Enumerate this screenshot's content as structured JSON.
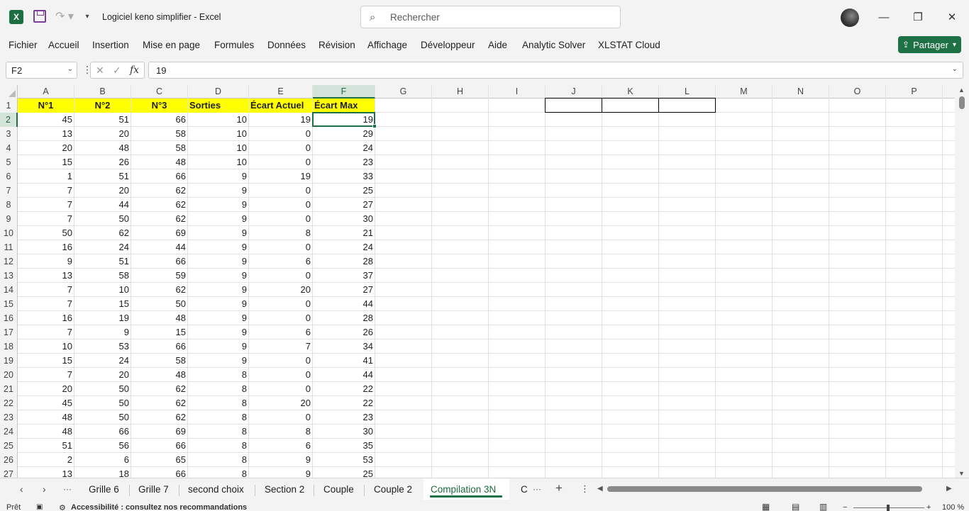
{
  "titlebar": {
    "app_logo": "X",
    "document_title": "Logiciel keno simplifier  -  Excel",
    "search_placeholder": "Rechercher",
    "icons": {
      "save": "save-icon",
      "redo": "redo-icon",
      "customize": "chevron-down-icon",
      "search": "search-icon",
      "minimize": "minimize-icon",
      "restore": "restore-icon",
      "close": "close-icon"
    },
    "window_controls": {
      "minimize": "—",
      "restore": "❐",
      "close": "✕"
    }
  },
  "menu": {
    "items": [
      "Fichier",
      "Accueil",
      "Insertion",
      "Mise en page",
      "Formules",
      "Données",
      "Révision",
      "Affichage",
      "Développeur",
      "Aide",
      "Analytic Solver",
      "XLSTAT Cloud"
    ],
    "share_label": "Partager"
  },
  "formula_bar": {
    "name_box": "F2",
    "formula_value": "19",
    "fx_label": "fx"
  },
  "sheet": {
    "columns": [
      "A",
      "B",
      "C",
      "D",
      "E",
      "F",
      "G",
      "H",
      "I",
      "J",
      "K",
      "L",
      "M",
      "N",
      "O",
      "P"
    ],
    "active_column": "F",
    "active_row": 2,
    "header_row": [
      "N°1",
      "N°2",
      "N°3",
      "Sorties",
      "Écart Actuel",
      "Écart Max"
    ],
    "rows": [
      [
        45,
        51,
        66,
        10,
        19,
        19
      ],
      [
        13,
        20,
        58,
        10,
        0,
        29
      ],
      [
        20,
        48,
        58,
        10,
        0,
        24
      ],
      [
        15,
        26,
        48,
        10,
        0,
        23
      ],
      [
        1,
        51,
        66,
        9,
        19,
        33
      ],
      [
        7,
        20,
        62,
        9,
        0,
        25
      ],
      [
        7,
        44,
        62,
        9,
        0,
        27
      ],
      [
        7,
        50,
        62,
        9,
        0,
        30
      ],
      [
        50,
        62,
        69,
        9,
        8,
        21
      ],
      [
        16,
        24,
        44,
        9,
        0,
        24
      ],
      [
        9,
        51,
        66,
        9,
        6,
        28
      ],
      [
        13,
        58,
        59,
        9,
        0,
        37
      ],
      [
        7,
        10,
        62,
        9,
        20,
        27
      ],
      [
        7,
        15,
        50,
        9,
        0,
        44
      ],
      [
        16,
        19,
        48,
        9,
        0,
        28
      ],
      [
        7,
        9,
        15,
        9,
        6,
        26
      ],
      [
        10,
        53,
        66,
        9,
        7,
        34
      ],
      [
        15,
        24,
        58,
        9,
        0,
        41
      ],
      [
        7,
        20,
        48,
        8,
        0,
        44
      ],
      [
        20,
        50,
        62,
        8,
        0,
        22
      ],
      [
        45,
        50,
        62,
        8,
        20,
        22
      ],
      [
        48,
        50,
        62,
        8,
        0,
        23
      ],
      [
        48,
        66,
        69,
        8,
        8,
        30
      ],
      [
        51,
        56,
        66,
        8,
        6,
        35
      ],
      [
        2,
        6,
        65,
        8,
        9,
        53
      ],
      [
        13,
        18,
        66,
        8,
        9,
        25
      ]
    ],
    "row_numbers": [
      1,
      2,
      3,
      4,
      5,
      6,
      7,
      8,
      9,
      10,
      11,
      12,
      13,
      14,
      15,
      16,
      17,
      18,
      19,
      20,
      21,
      22,
      23,
      24,
      25,
      26,
      27
    ]
  },
  "sheet_tabs": {
    "tabs": [
      "Grille 6",
      "Grille 7",
      "second choix",
      "Section 2",
      "Couple",
      "Couple 2",
      "Compilation 3N",
      "C"
    ],
    "active": "Compilation 3N",
    "more": "···",
    "add": "+"
  },
  "status_bar": {
    "ready": "Prêt",
    "accessibility": "Accessibilité : consultez nos recommandations",
    "zoom": "100 %"
  },
  "colors": {
    "accent": "#1e7145",
    "header_fill": "#ffff00"
  }
}
